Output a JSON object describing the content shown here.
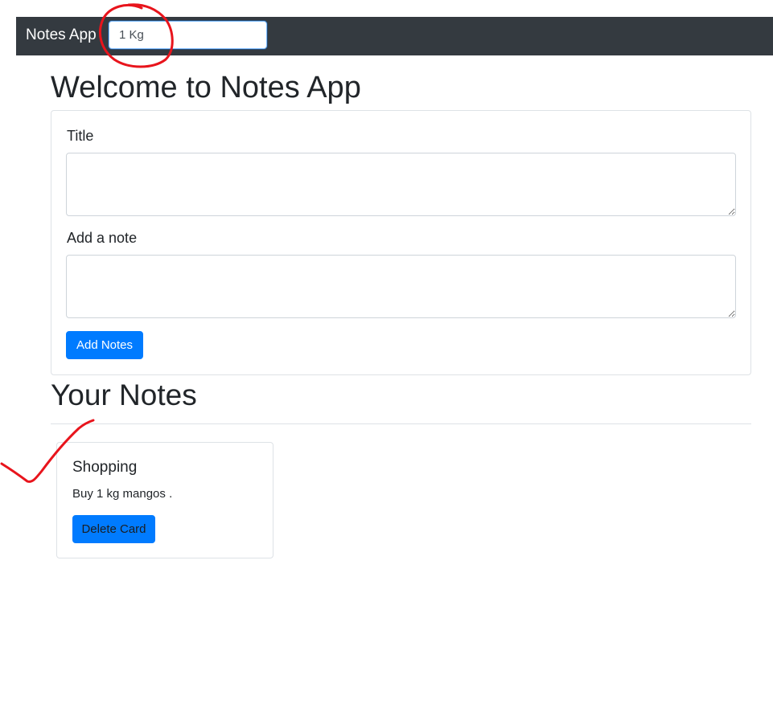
{
  "navbar": {
    "brand": "Notes App",
    "search_value": "1 Kg"
  },
  "main": {
    "heading": "Welcome to Notes App",
    "form": {
      "title_label": "Title",
      "note_label": "Add a note",
      "add_button": "Add Notes"
    },
    "notes_heading": "Your Notes",
    "notes": [
      {
        "title": "Shopping",
        "text": "Buy 1 kg mangos .",
        "delete_button": "Delete Card"
      }
    ]
  },
  "colors": {
    "navbar_bg": "#343a40",
    "primary": "#007bff",
    "annotation": "#e8141c"
  }
}
